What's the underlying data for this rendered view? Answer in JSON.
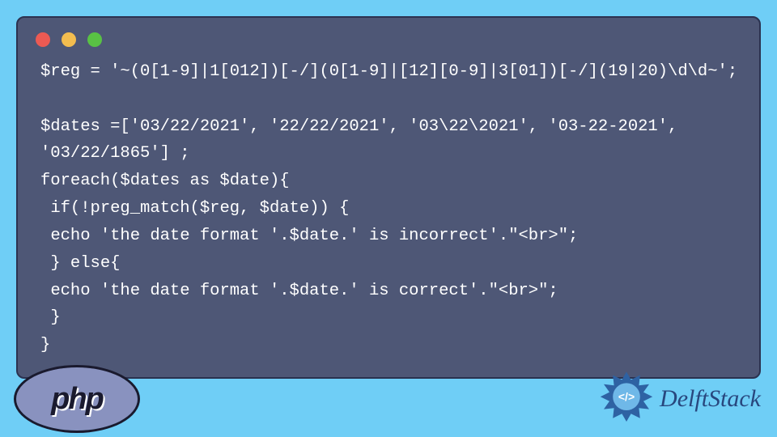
{
  "code": {
    "line1": "$reg = '~(0[1-9]|1[012])[-/](0[1-9]|[12][0-9]|3[01])[-/](19|20)\\d\\d~';",
    "line2": "",
    "line3": "$dates =['03/22/2021', '22/22/2021', '03\\22\\2021', '03-22-2021', '03/22/1865'] ;",
    "line4": "foreach($dates as $date){",
    "line5": " if(!preg_match($reg, $date)) {",
    "line6": " echo 'the date format '.$date.' is incorrect'.\"<br>\";",
    "line7": " } else{",
    "line8": " echo 'the date format '.$date.' is correct'.\"<br>\";",
    "line9": " }",
    "line10": "}"
  },
  "footer": {
    "php_label": "php",
    "brand": "DelftStack"
  },
  "colors": {
    "page_bg": "#6fcef6",
    "panel_bg": "#4e5776",
    "panel_border": "#2b3250",
    "code_text": "#ffffff",
    "dot_red": "#ec5a53",
    "dot_yellow": "#f3bd4f",
    "dot_green": "#59c244",
    "php_fill": "#8992bf",
    "php_text": "#1a1a2e",
    "brand_text": "#28477e",
    "badge_accent": "#2e62a3"
  }
}
